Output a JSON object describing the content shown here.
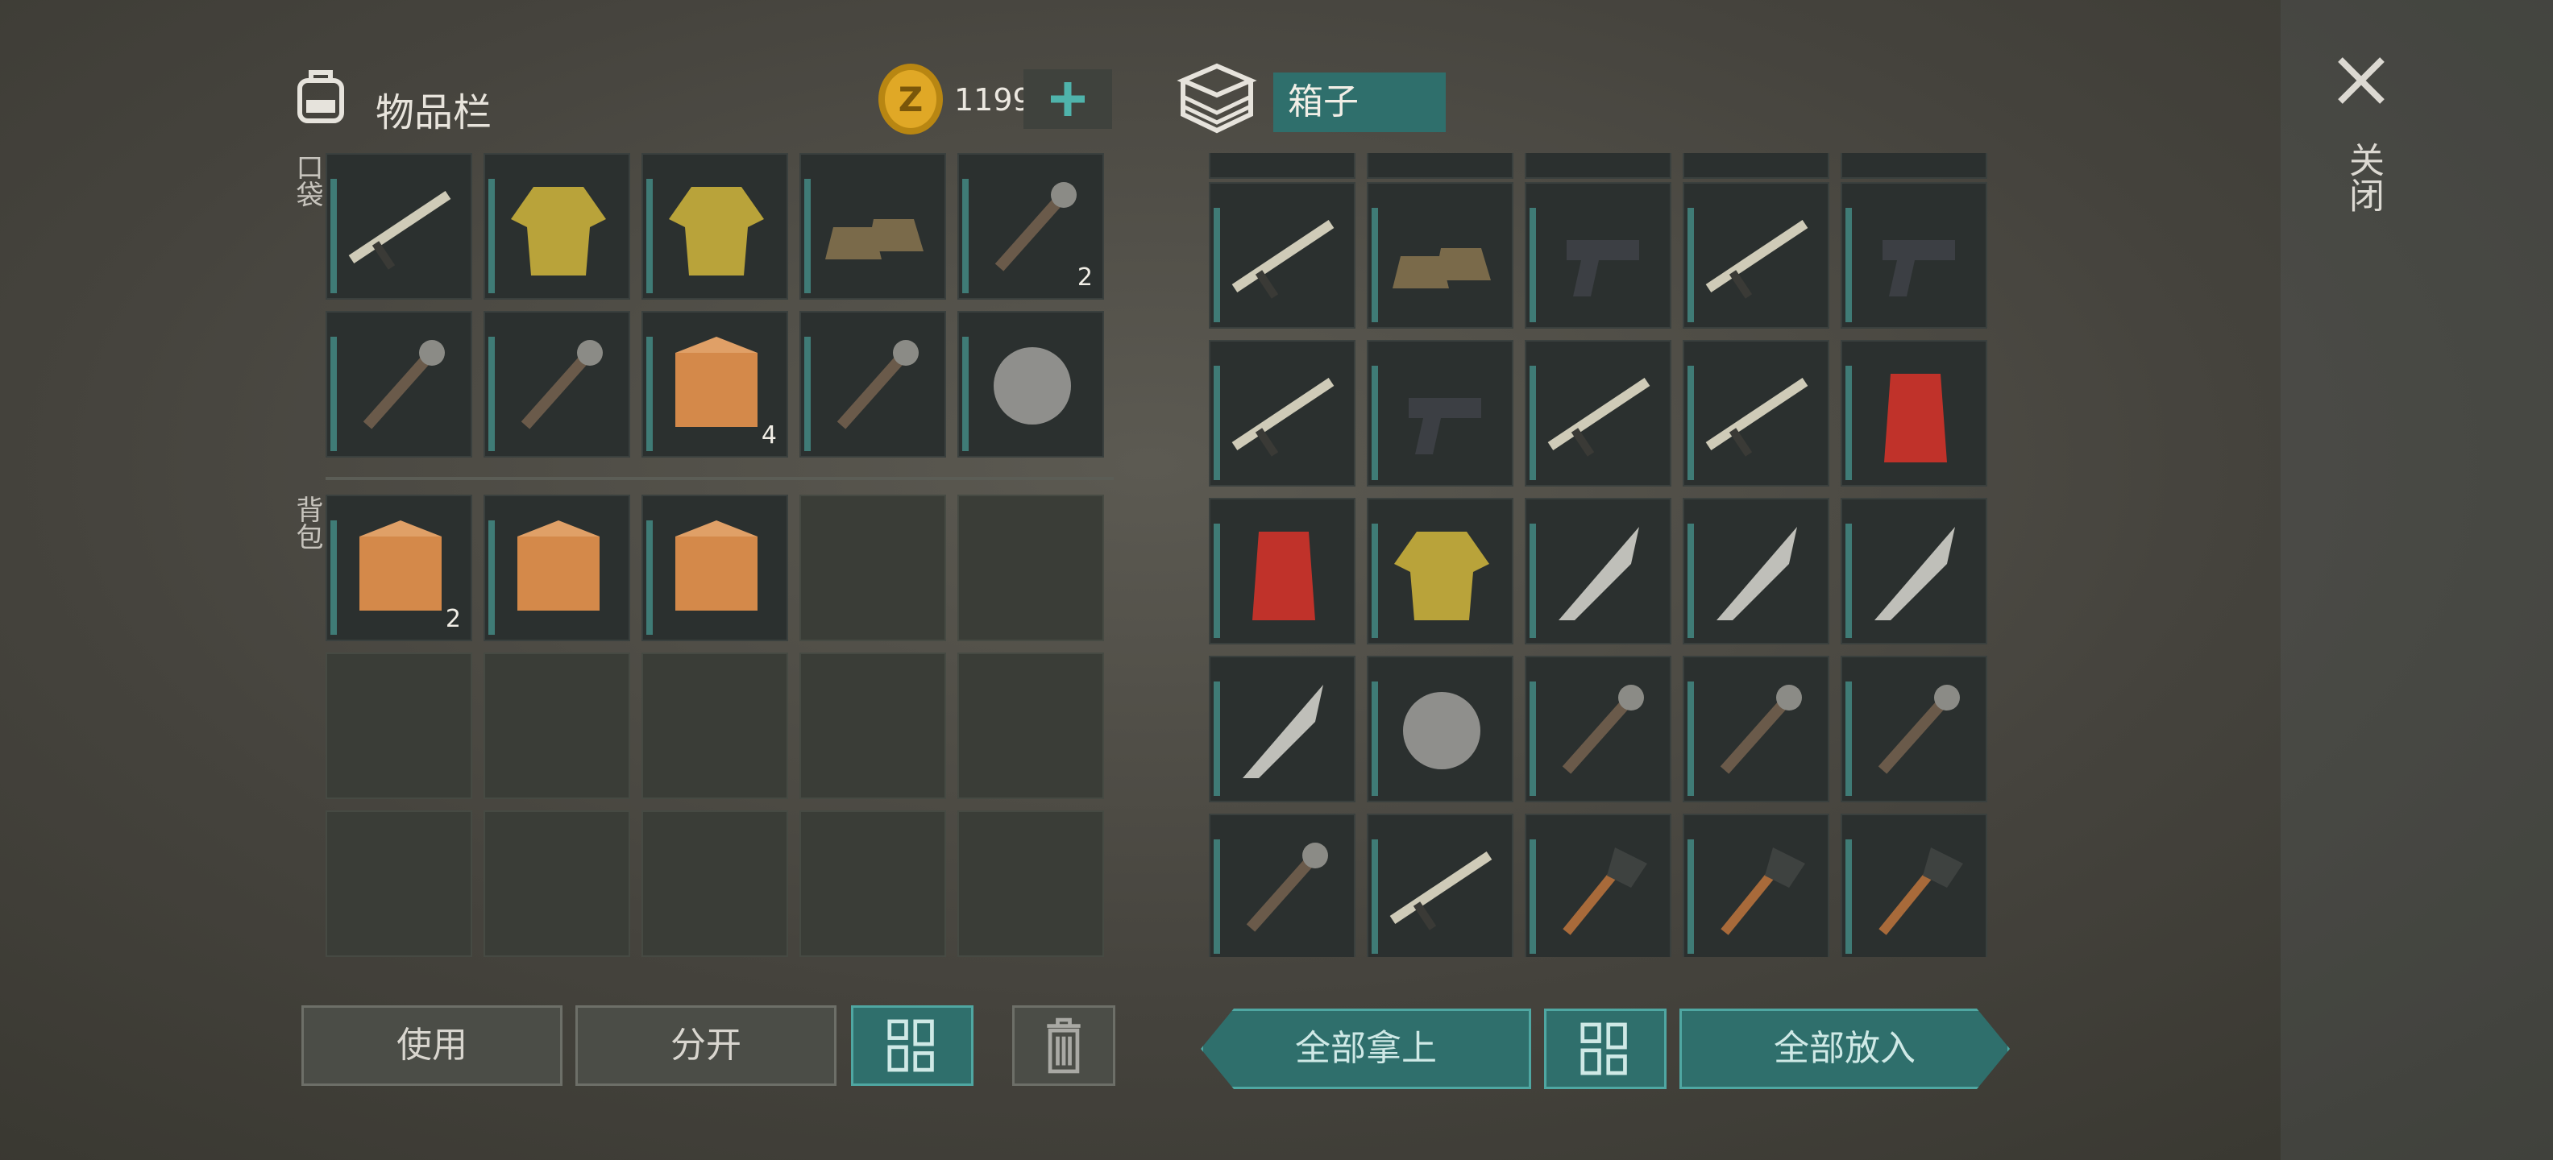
{
  "inventory": {
    "title": "物品栏",
    "currency": "1199",
    "section_pocket": "口袋",
    "section_backpack": "背包"
  },
  "chest": {
    "title": "箱子"
  },
  "close_label": "关闭",
  "buttons": {
    "use": "使用",
    "split": "分开",
    "take_all": "全部拿上",
    "put_all": "全部放入"
  },
  "pocket_items": [
    {
      "icon": "assault-rifle-icon",
      "qty": ""
    },
    {
      "icon": "yellow-jacket-icon",
      "qty": ""
    },
    {
      "icon": "police-vest-icon",
      "qty": ""
    },
    {
      "icon": "boots-icon",
      "qty": ""
    },
    {
      "icon": "parts-icon",
      "qty": "2"
    },
    {
      "icon": "binoculars-icon",
      "qty": ""
    },
    {
      "icon": "binoculars-icon",
      "qty": ""
    },
    {
      "icon": "medkit-bag-icon",
      "qty": "4"
    },
    {
      "icon": "gas-mask-icon",
      "qty": ""
    },
    {
      "icon": "propeller-icon",
      "qty": ""
    }
  ],
  "backpack_items": [
    {
      "icon": "tin-can-icon",
      "qty": "2"
    },
    {
      "icon": "supply-crate-icon",
      "qty": ""
    },
    {
      "icon": "supply-crate-icon",
      "qty": ""
    }
  ],
  "chest_items": [
    "scoped-rifle-icon",
    "green-boots-icon",
    "pistol-icon",
    "m16-rifle-icon",
    "flare-gun-icon",
    "crossbow-icon",
    "desert-pistol-icon",
    "crossbow-icon",
    "sniper-rifle-icon",
    "red-pants-icon",
    "santa-hat-icon",
    "santa-coat-icon",
    "glaive-icon",
    "knife-icon",
    "sword-icon",
    "glaive-icon",
    "blueprint-icon",
    "saw-club-icon",
    "saw-club-icon",
    "chainsaw-icon",
    "chainsaw-icon",
    "crossbow-icon",
    "shovel-icon",
    "shovel-icon",
    "shovel-icon"
  ]
}
